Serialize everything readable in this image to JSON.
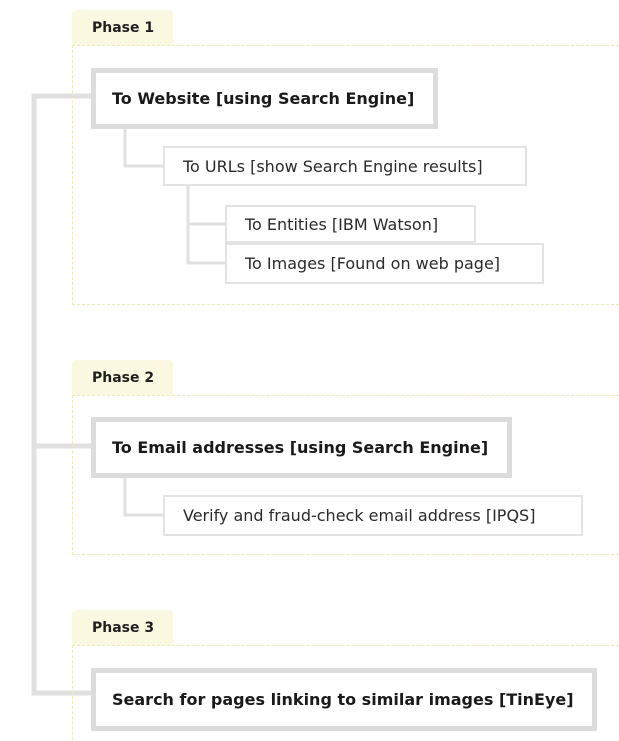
{
  "diagram": {
    "phases": [
      {
        "label": "Phase 1",
        "main": "To Website [using Search Engine]",
        "children": [
          {
            "label": "To URLs [show Search Engine results]",
            "children": [
              {
                "label": "To Entities [IBM Watson]"
              },
              {
                "label": "To Images [Found on web page]"
              }
            ]
          }
        ]
      },
      {
        "label": "Phase 2",
        "main": "To Email addresses [using Search Engine]",
        "children": [
          {
            "label": "Verify and fraud-check email address [IPQS]"
          }
        ]
      },
      {
        "label": "Phase 3",
        "main": "Search for pages linking to similar images [TinEye]",
        "children": []
      }
    ]
  },
  "colors": {
    "tab_background": "#fbf8e2",
    "phase_border": "#ede9b7",
    "connector": "#e0e0e0",
    "main_border": "#dcdcdc",
    "sub_border": "#e3e3e3"
  }
}
